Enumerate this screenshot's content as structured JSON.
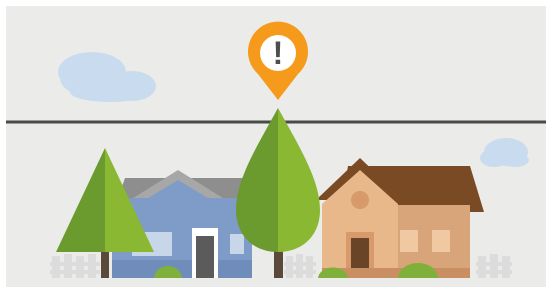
{
  "scene": {
    "marker_glyph": "!",
    "marker_icon": "alert-pin-icon",
    "colors": {
      "background": "#ebebea",
      "frame": "#ffffff",
      "horizon_line": "#4a4a4a",
      "marker_orange": "#f59a1b",
      "marker_inner": "#ffffff",
      "marker_glyph": "#4d4d4d",
      "cloud": "#c9dcef",
      "tree_light": "#8ab833",
      "tree_dark": "#6b9a2f",
      "trunk": "#5b4a3a",
      "house_blue_wall": "#7f9cc8",
      "house_blue_roof": "#8e8e8e",
      "house_brown_wall": "#d8a47a",
      "house_brown_roof": "#7a4a24",
      "fence": "#dcdcdc",
      "bush": "#7fb13a"
    }
  }
}
